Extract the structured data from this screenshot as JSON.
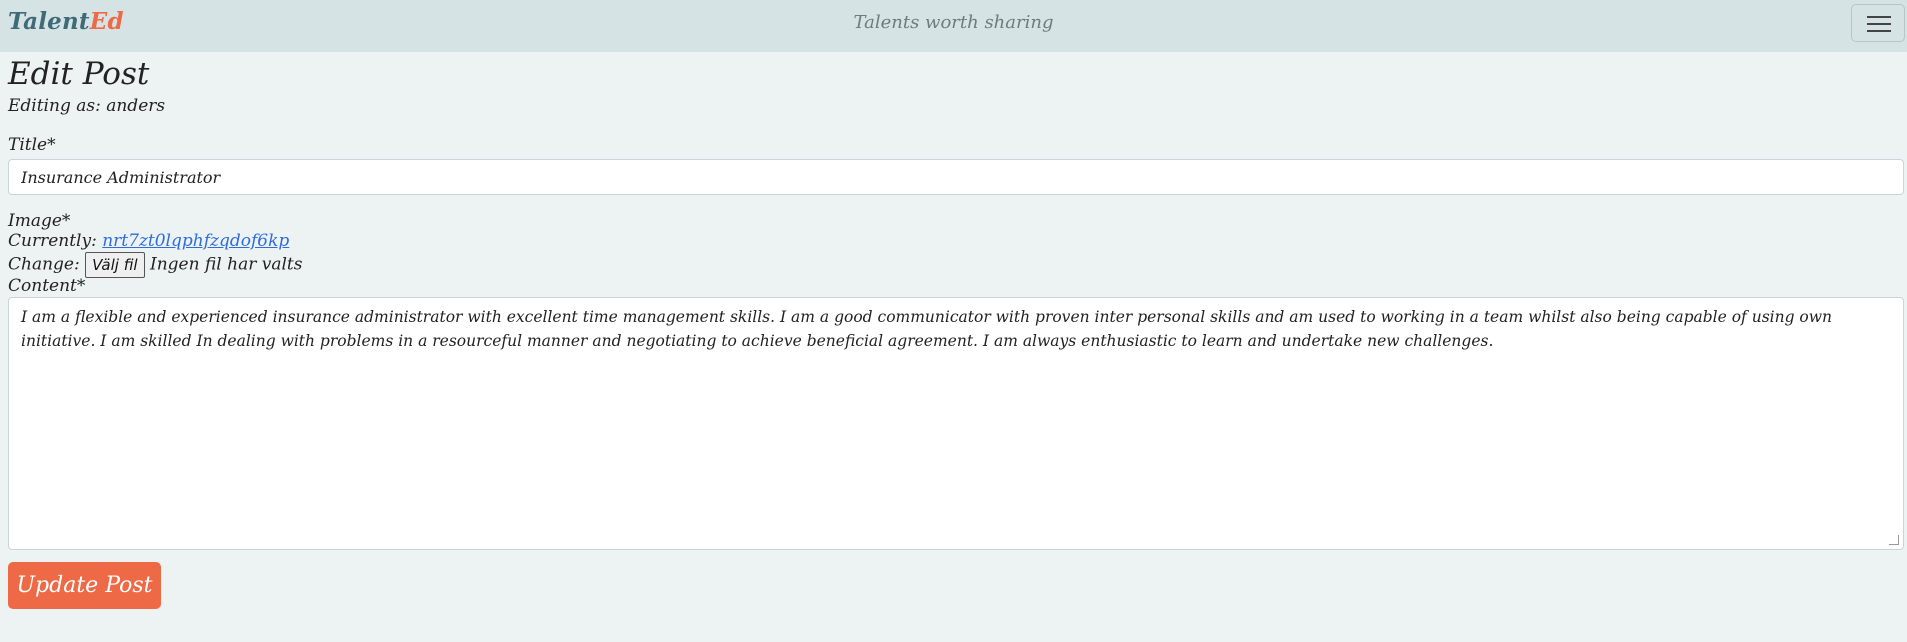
{
  "navbar": {
    "brand_part1": "Talent",
    "brand_part2": "Ed",
    "tagline": "Talents worth sharing"
  },
  "page": {
    "heading": "Edit Post",
    "editing_as": "Editing as: anders"
  },
  "form": {
    "title_label": "Title*",
    "title_value": "Insurance Administrator",
    "image_label": "Image*",
    "currently_label": "Currently:",
    "current_image": "nrt7zt0lqphfzqdof6kp",
    "change_label": "Change:",
    "file_button": "Välj fil",
    "file_status": "Ingen fil har valts",
    "content_label": "Content*",
    "content_value": "I am a flexible and experienced insurance administrator with excellent time management skills. I am a good communicator with proven inter personal skills and am used to working in a team whilst also being capable of using own initiative. I am skilled In dealing with problems in a resourceful manner and negotiating to achieve beneficial agreement. I am always enthusiastic to learn and undertake new challenges.",
    "submit_label": "Update Post"
  },
  "colors": {
    "accent": "#ee6a47",
    "brand_primary": "#3f6b78",
    "navbar_bg": "#d6e3e5",
    "page_bg": "#edf3f3",
    "link": "#2f6ce0"
  }
}
